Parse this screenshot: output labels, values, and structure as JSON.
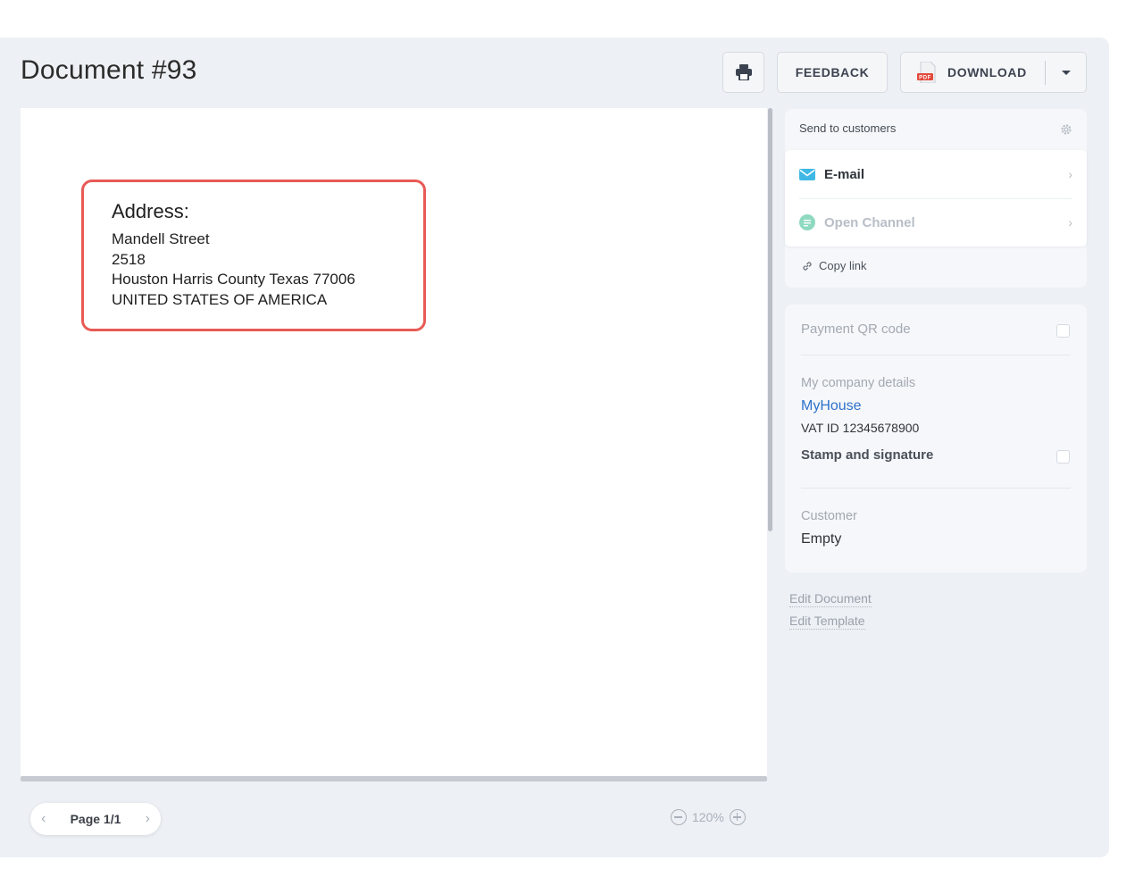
{
  "header": {
    "title": "Document #93",
    "feedback_label": "FEEDBACK",
    "download_label": "DOWNLOAD",
    "print_icon": "printer-icon",
    "pdf_icon": "pdf-icon",
    "pdf_icon_text": "PDF"
  },
  "document": {
    "address_heading": "Address:",
    "address_lines": [
      "Mandell Street",
      "2518",
      "Houston Harris County Texas 77006",
      "UNITED STATES OF AMERICA"
    ],
    "highlight_color": "#e85a55"
  },
  "pager": {
    "label": "Page 1/1",
    "prev": "‹",
    "next": "›"
  },
  "zoom": {
    "level": "120%"
  },
  "send": {
    "header": "Send to customers",
    "channels": [
      {
        "label": "E-mail",
        "icon": "envelope-icon",
        "color": "#2f343b"
      },
      {
        "label": "Open Channel",
        "icon": "chat-icon",
        "color": "#b8bec7"
      }
    ],
    "copy_link": "Copy link"
  },
  "details": {
    "payment_qr": "Payment QR code",
    "company_label": "My company details",
    "company_name": "MyHouse",
    "vat": "VAT ID 12345678900",
    "stamp": "Stamp and signature",
    "customer_label": "Customer",
    "customer_value": "Empty"
  },
  "links": {
    "edit_document": "Edit Document",
    "edit_template": "Edit Template"
  },
  "colors": {
    "accent_blue": "#2c73c9",
    "email_icon": "#3fb8e6",
    "channel_icon": "#8fd9c1"
  }
}
